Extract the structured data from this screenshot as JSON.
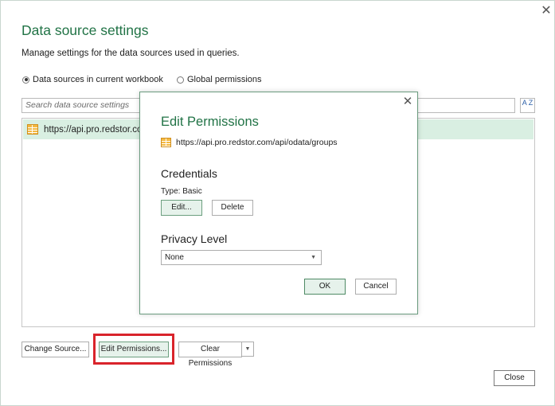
{
  "window": {
    "title": "Data source settings",
    "subtitle": "Manage settings for the data sources used in queries.",
    "close_glyph": "✕"
  },
  "scope": {
    "options": [
      {
        "label": "Data sources in current workbook",
        "selected": true
      },
      {
        "label": "Global permissions",
        "selected": false
      }
    ]
  },
  "search": {
    "placeholder": "Search data source settings",
    "sort_glyph": "A Z"
  },
  "sources": [
    {
      "label": "https://api.pro.redstor.com/api/odata/groups",
      "visible_text": "https://api.pro.redstor.co",
      "icon": "table-icon",
      "selected": true
    }
  ],
  "bottom_buttons": {
    "change_source": "Change Source...",
    "edit_permissions": "Edit Permissions...",
    "clear_permissions": "Clear Permissions",
    "close": "Close"
  },
  "dialog": {
    "title": "Edit Permissions",
    "url": "https://api.pro.redstor.com/api/odata/groups",
    "close_glyph": "✕",
    "credentials": {
      "heading": "Credentials",
      "type_label": "Type: Basic",
      "edit_button": "Edit...",
      "delete_button": "Delete"
    },
    "privacy": {
      "heading": "Privacy Level",
      "selected": "None"
    },
    "ok_button": "OK",
    "cancel_button": "Cancel"
  },
  "colors": {
    "accent_green": "#217346",
    "selection_green": "#d9efe2",
    "highlight_red": "#d9242b"
  }
}
